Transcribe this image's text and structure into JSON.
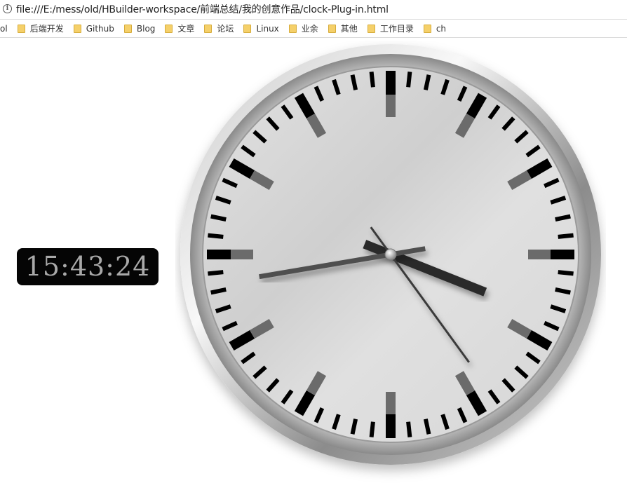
{
  "address_bar": {
    "info_icon": "info-icon",
    "url": "file:///E:/mess/old/HBuilder-workspace/前端总结/我的创意作品/clock-Plug-in.html"
  },
  "bookmarks": [
    {
      "label": "ol",
      "icon": ""
    },
    {
      "label": "后端开发",
      "icon": "folder-icon"
    },
    {
      "label": "Github",
      "icon": "folder-icon"
    },
    {
      "label": "Blog",
      "icon": "folder-icon"
    },
    {
      "label": "文章",
      "icon": "folder-icon"
    },
    {
      "label": "论坛",
      "icon": "folder-icon"
    },
    {
      "label": "Linux",
      "icon": "folder-icon"
    },
    {
      "label": "业余",
      "icon": "folder-icon"
    },
    {
      "label": "其他",
      "icon": "folder-icon"
    },
    {
      "label": "工作目录",
      "icon": "folder-icon"
    },
    {
      "label": "ch",
      "icon": "folder-icon"
    }
  ],
  "digital_clock": {
    "time": "15:43:24"
  },
  "analog_clock": {
    "hours": 15,
    "minutes": 43,
    "seconds": 24,
    "face_color": "#d9d9d9",
    "tick_color": "#000000",
    "rim_color": "#a0a0a0"
  }
}
